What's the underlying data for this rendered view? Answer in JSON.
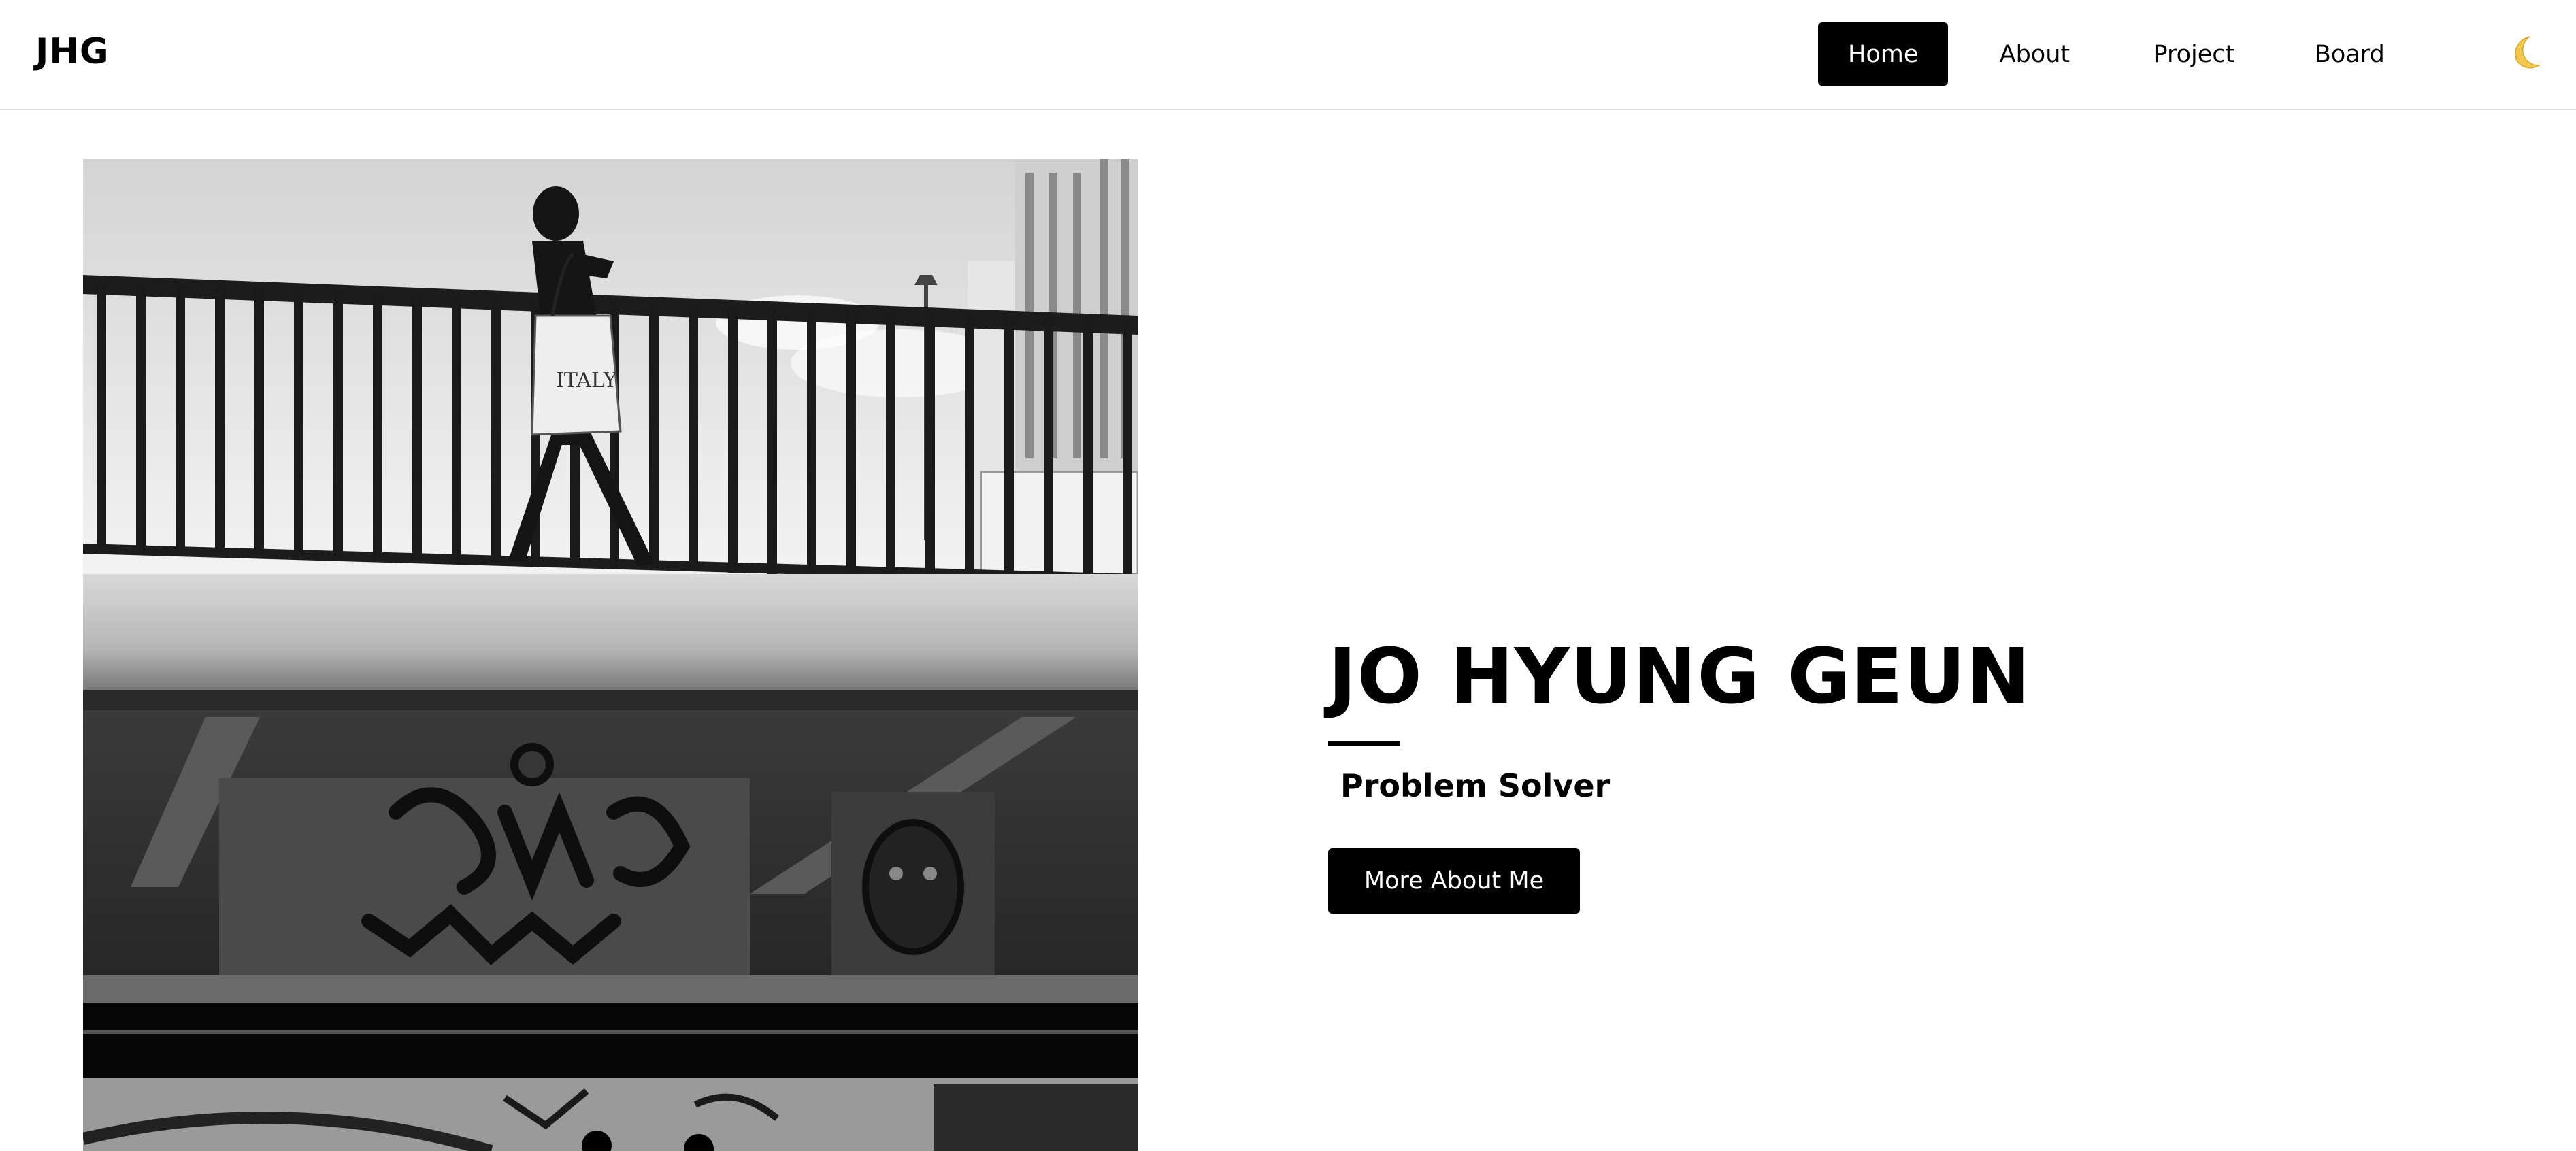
{
  "header": {
    "brand": "JHG",
    "nav": [
      {
        "label": "Home",
        "active": true
      },
      {
        "label": "About",
        "active": false
      },
      {
        "label": "Project",
        "active": false
      },
      {
        "label": "Board",
        "active": false
      }
    ],
    "theme_toggle_icon": "moon-icon"
  },
  "hero": {
    "image": "black-and-white photo of a person walking across a railed bridge above a graffiti-covered underpass",
    "name": "JO HYUNG GEUN",
    "role": "Problem Solver",
    "button_label": "More About Me"
  },
  "colors": {
    "primary": "#000000",
    "background": "#ffffff",
    "divider": "#dcdcdc",
    "moon": "#f2c94c"
  }
}
